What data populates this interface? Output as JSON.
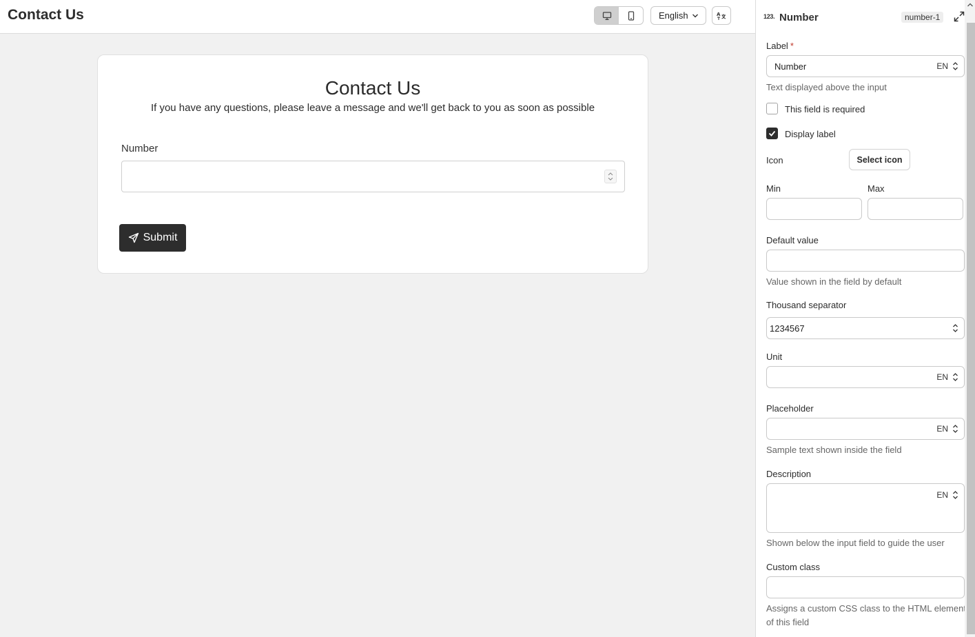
{
  "topbar": {
    "title": "Contact Us",
    "language": "English",
    "device_icons": [
      "desktop-icon",
      "mobile-icon"
    ],
    "translate_icon": "translate-icon"
  },
  "form": {
    "title": "Contact Us",
    "subtitle": "If you have any questions, please leave a message and we'll get back to you as soon as possible",
    "field_label": "Number",
    "submit_label": "Submit"
  },
  "panel": {
    "icon_text": "123.",
    "title": "Number",
    "badge": "number-1",
    "label": {
      "title": "Label",
      "required_mark": "*",
      "value": "Number",
      "lang": "EN",
      "help": "Text displayed above the input"
    },
    "required_checkbox": {
      "label": "This field is required",
      "checked": false
    },
    "display_label_checkbox": {
      "label": "Display label",
      "checked": true
    },
    "icon": {
      "label": "Icon",
      "button": "Select icon"
    },
    "min": {
      "label": "Min",
      "value": ""
    },
    "max": {
      "label": "Max",
      "value": ""
    },
    "default_value": {
      "label": "Default value",
      "value": "",
      "help": "Value shown in the field by default"
    },
    "thousand_separator": {
      "label": "Thousand separator",
      "value": "1234567"
    },
    "unit": {
      "label": "Unit",
      "value": "",
      "lang": "EN"
    },
    "placeholder": {
      "label": "Placeholder",
      "value": "",
      "lang": "EN",
      "help": "Sample text shown inside the field"
    },
    "description": {
      "label": "Description",
      "value": "",
      "lang": "EN",
      "help": "Shown below the input field to guide the user"
    },
    "custom_class": {
      "label": "Custom class",
      "value": "",
      "help_line1": "Assigns a custom CSS class to the HTML element",
      "help_line2": "of this field"
    }
  },
  "colors": {
    "accent": "#2d2d2d",
    "required": "#c0392b",
    "canvas": "#f1f1f1"
  }
}
